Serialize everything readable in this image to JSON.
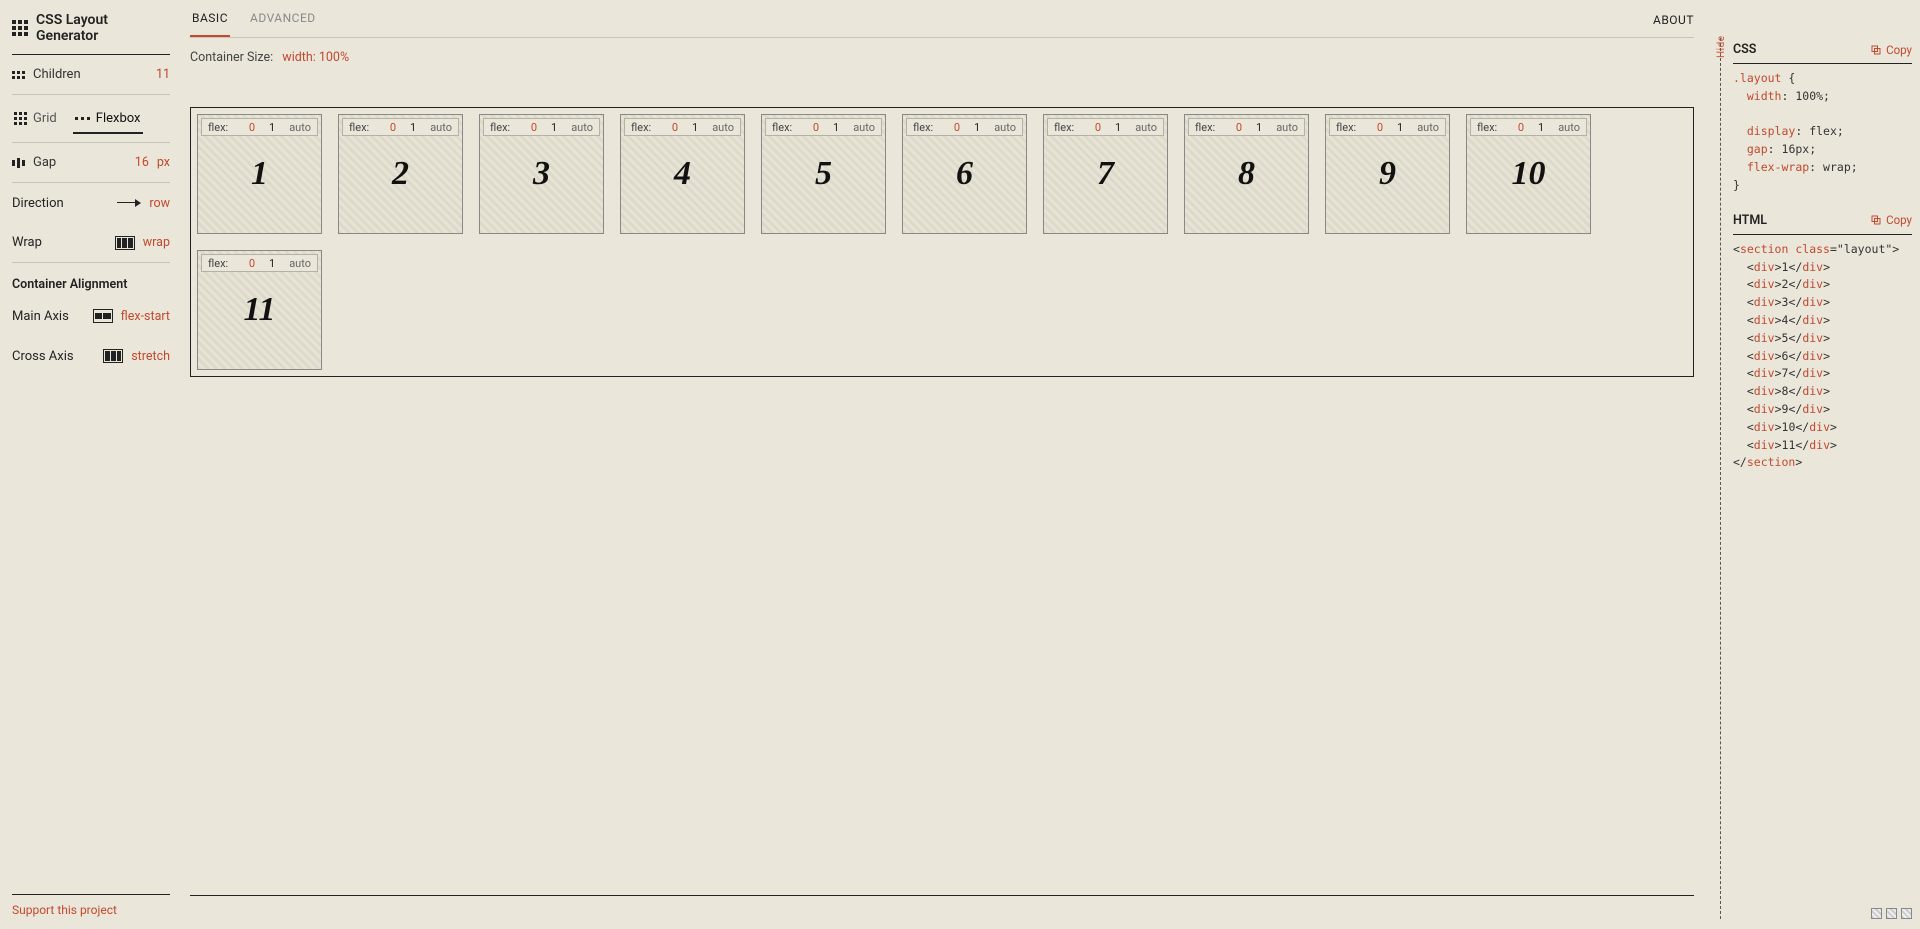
{
  "title": "CSS Layout Generator",
  "sidebar": {
    "children_label": "Children",
    "children_count": "11",
    "tabs": {
      "grid": "Grid",
      "flex": "Flexbox"
    },
    "gap_label": "Gap",
    "gap_value": "16",
    "gap_unit": "px",
    "direction_label": "Direction",
    "direction_value": "row",
    "wrap_label": "Wrap",
    "wrap_value": "wrap",
    "align_header": "Container Alignment",
    "main_axis_label": "Main Axis",
    "main_axis_value": "flex-start",
    "cross_axis_label": "Cross Axis",
    "cross_axis_value": "stretch",
    "support": "Support this project"
  },
  "main": {
    "tabs": {
      "basic": "BASIC",
      "advanced": "ADVANCED"
    },
    "about": "ABOUT",
    "container_label": "Container Size:",
    "container_value": "width: 100%",
    "cell_flex_label": "flex:",
    "cell_grow": "0",
    "cell_shrink": "1",
    "cell_basis": "auto",
    "cells": [
      "1",
      "2",
      "3",
      "4",
      "5",
      "6",
      "7",
      "8",
      "9",
      "10",
      "11"
    ]
  },
  "code": {
    "hide": "Hide",
    "css_title": "CSS",
    "html_title": "HTML",
    "copy": "Copy",
    "css": {
      "sel": ".layout",
      "ob": "{",
      "p1": "width",
      "v1": "100%",
      "p2": "display",
      "v2": "flex",
      "p3": "gap",
      "v3": "16px",
      "p4": "flex-wrap",
      "v4": "wrap",
      "cb": "}"
    },
    "html": {
      "open_tag": "section",
      "attr": "class",
      "attr_v": "\"layout\"",
      "child_tag": "div",
      "children": [
        "1",
        "2",
        "3",
        "4",
        "5",
        "6",
        "7",
        "8",
        "9",
        "10",
        "11"
      ]
    }
  }
}
